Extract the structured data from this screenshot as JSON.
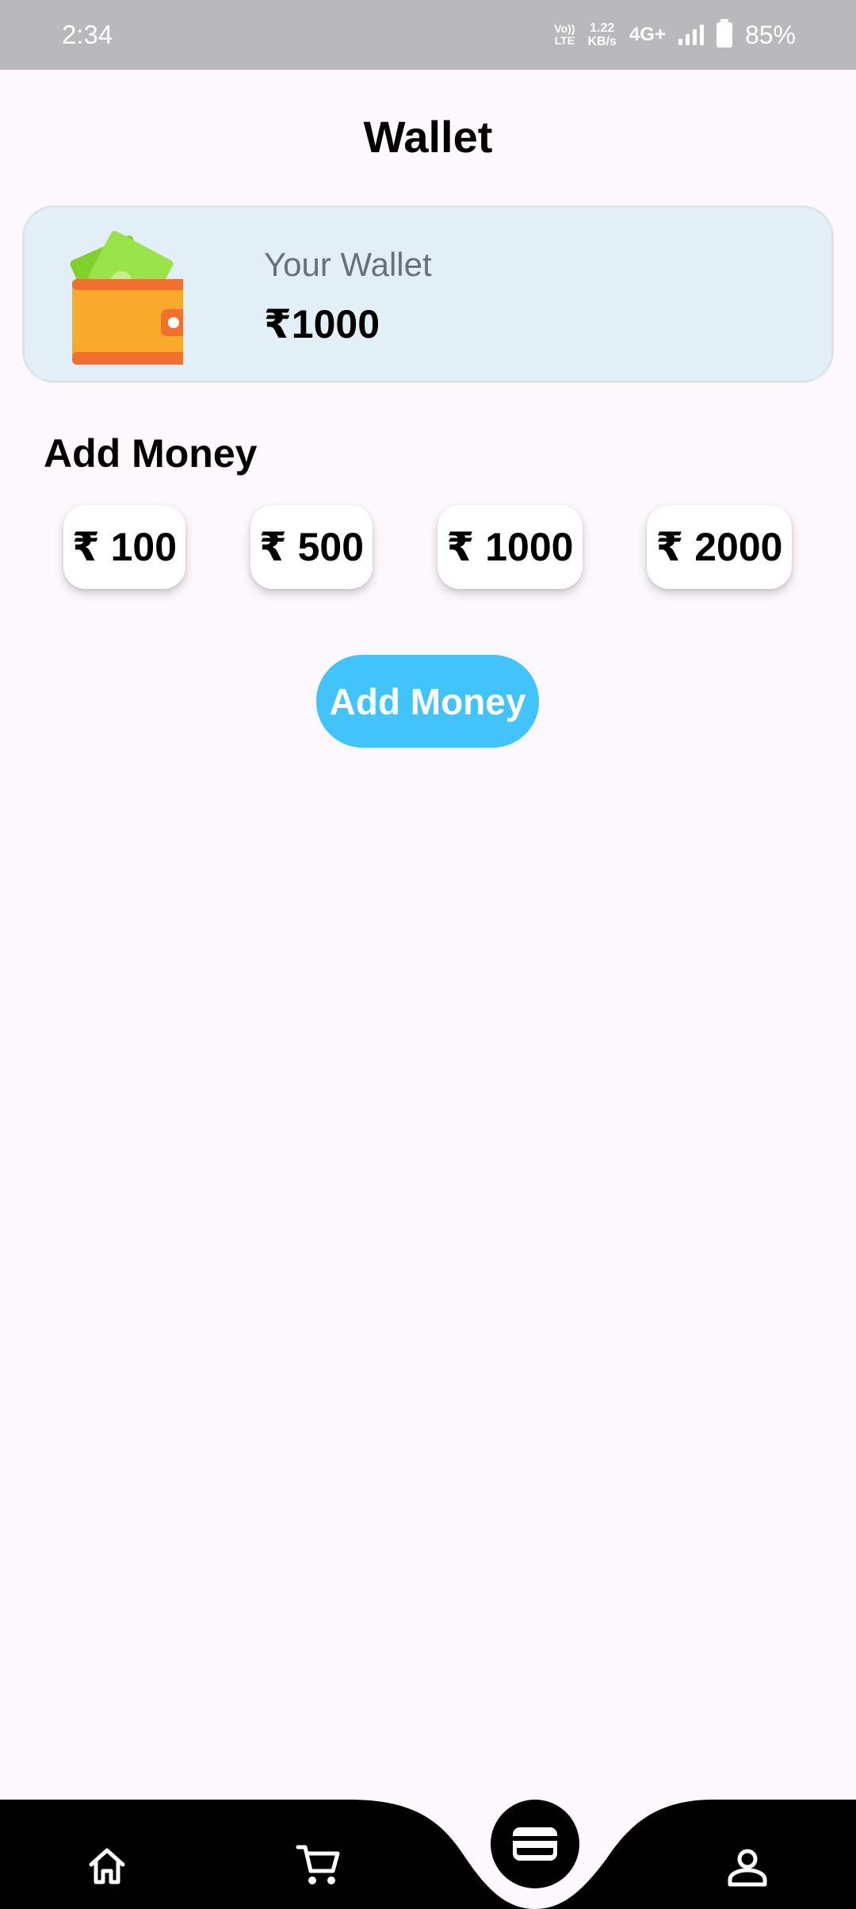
{
  "status_bar": {
    "time": "2:34",
    "volte_line1": "Vo))",
    "volte_line2": "LTE",
    "speed_value": "1.22",
    "speed_unit": "KB/s",
    "network": "4G+",
    "battery_percent": "85%"
  },
  "header": {
    "title": "Wallet"
  },
  "wallet_card": {
    "label": "Your Wallet",
    "balance": "₹1000",
    "icon": "wallet-with-cash-icon"
  },
  "add_money": {
    "section_title": "Add Money",
    "amounts": [
      "₹ 100",
      "₹ 500",
      "₹ 1000",
      "₹ 2000"
    ],
    "button_label": "Add Money",
    "button_color": "#42c4fb"
  },
  "bottom_nav": {
    "items": [
      {
        "icon": "home-icon"
      },
      {
        "icon": "cart-icon"
      },
      {
        "icon": "wallet-icon",
        "selected": true
      },
      {
        "icon": "profile-icon"
      }
    ]
  }
}
